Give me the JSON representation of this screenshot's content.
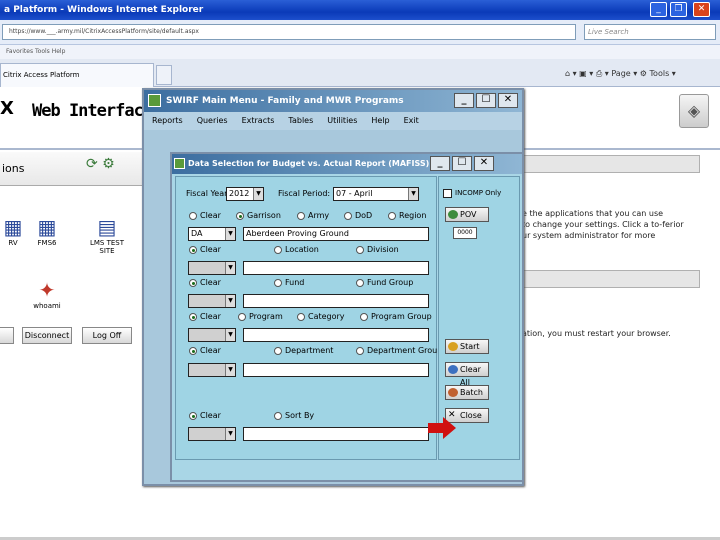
{
  "browser": {
    "title": "a Platform - Windows Internet Explorer",
    "address": "https://www.___.army.mil/CitrixAccessPlatform/site/default.aspx",
    "search_placeholder": "Live Search",
    "menu": "Favorites   Tools   Help",
    "tab_label": "Citrix Access Platform",
    "tools": "⌂ ▾  ▣ ▾  ⎙ ▾  Page ▾  ⚙ Tools ▾"
  },
  "page": {
    "logo_letter": "X",
    "title": "Web Interface",
    "apps_title": "ions",
    "apps": [
      {
        "label": "RV",
        "icon": "app-icon"
      },
      {
        "label": "FMS6",
        "icon": "app-icon"
      },
      {
        "label": "LMS TEST SITE",
        "icon": "app-icon"
      },
      {
        "label": "whoami",
        "icon": "app-icon"
      }
    ],
    "disconnect_label": "Disconnect",
    "logoff_label": "Log Off",
    "right_text_1": "e the applications that you can use",
    "right_text_2": "to change your settings. Click a to-ferior",
    "right_text_3": "ur system administrator for more",
    "right_text_4": "ation, you must restart your browser."
  },
  "swirf": {
    "title": "SWIRF Main Menu - Family and MWR Programs",
    "menu": [
      "Reports",
      "Queries",
      "Extracts",
      "Tables",
      "Utilities",
      "Help",
      "Exit"
    ]
  },
  "dialog": {
    "title": "Data Selection for Budget vs. Actual Report (MAFISS) *",
    "fiscal_year_label": "Fiscal Year:",
    "fiscal_year_value": "2012",
    "fiscal_period_label": "Fiscal Period:",
    "fiscal_period_value": "07 - April",
    "incomp_label": "INCOMP Only",
    "rows": [
      {
        "options": [
          "Clear",
          "Garrison",
          "Army",
          "DoD",
          "Region"
        ],
        "select": "DA",
        "text": "Aberdeen Proving Ground"
      },
      {
        "options": [
          "Clear",
          "Location",
          "Division"
        ],
        "select": "",
        "text": ""
      },
      {
        "options": [
          "Clear",
          "Fund",
          "Fund Group"
        ],
        "select": "",
        "text": ""
      },
      {
        "options": [
          "Clear",
          "Program",
          "Category",
          "Program Group"
        ],
        "select": "",
        "text": ""
      },
      {
        "options": [
          "Clear",
          "Department",
          "Department Group"
        ],
        "select": "",
        "text": ""
      },
      {
        "options": [
          "Clear",
          "Sort By"
        ],
        "select": "",
        "text": ""
      }
    ],
    "pov_label": "POV",
    "pov_value": "0000",
    "start_label": "Start",
    "clear_all_label": "Clear All",
    "batch_label": "Batch",
    "close_label": "Close"
  }
}
